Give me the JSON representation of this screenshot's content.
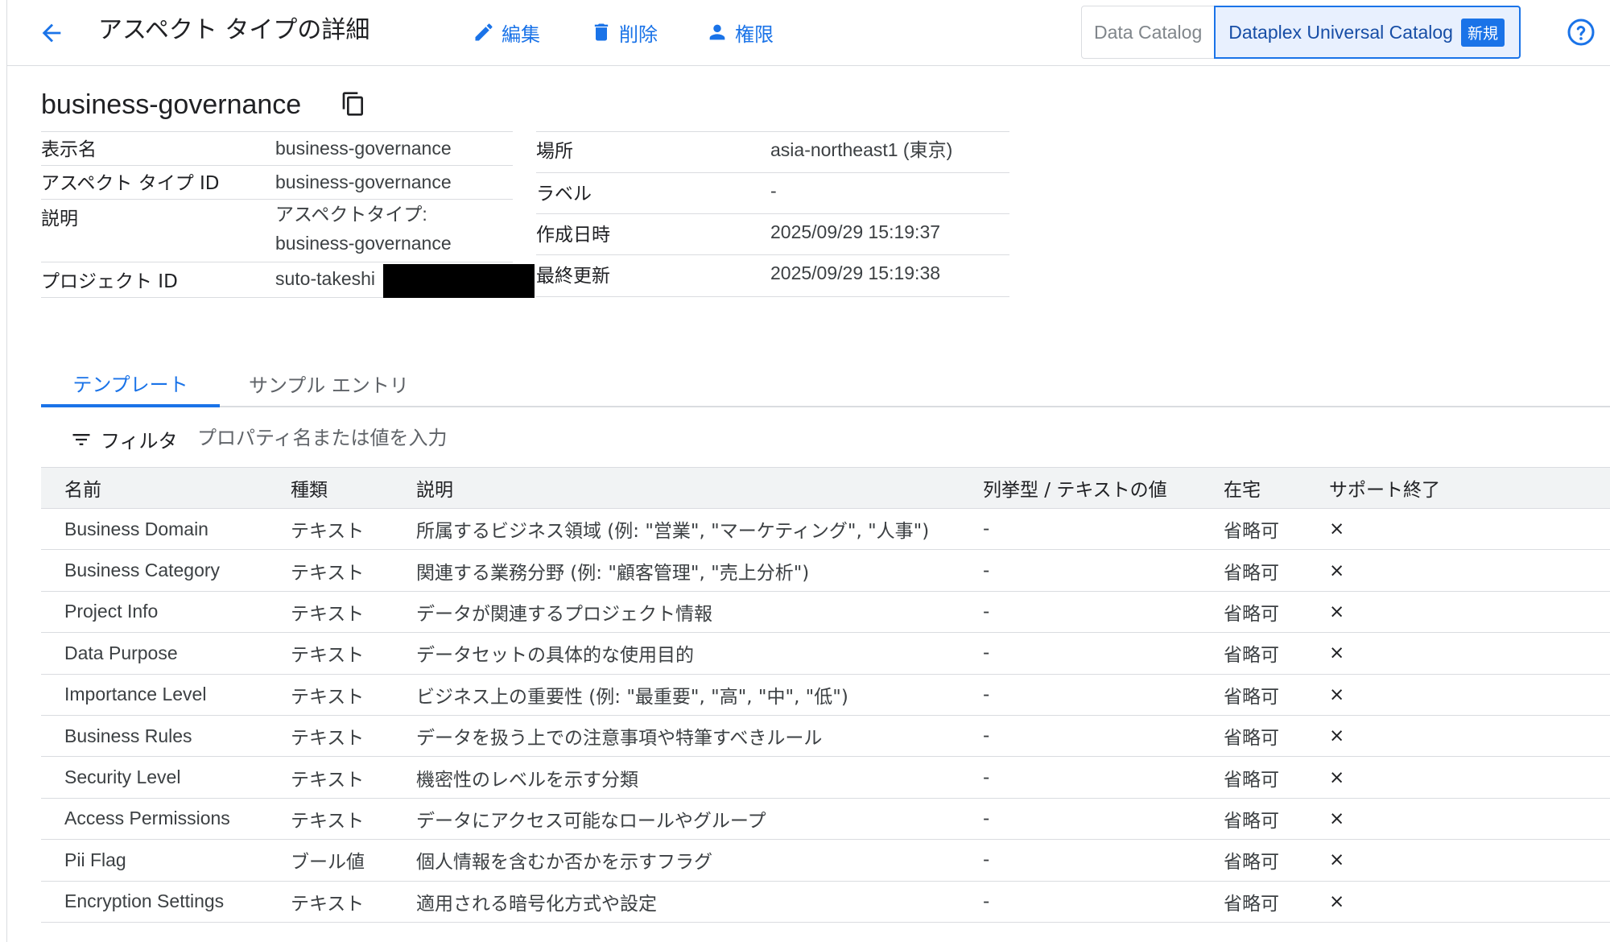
{
  "header": {
    "title": "アスペクト タイプの詳細",
    "actions": {
      "edit": "編集",
      "delete": "削除",
      "permissions": "権限"
    },
    "catalog_toggle": {
      "options": [
        "Data Catalog",
        "Dataplex Universal Catalog"
      ],
      "active": "Dataplex Universal Catalog",
      "badge": "新規"
    }
  },
  "resource": {
    "name": "business-governance"
  },
  "details_left": [
    {
      "label": "表示名",
      "value": "business-governance"
    },
    {
      "label": "アスペクト タイプ ID",
      "value": "business-governance"
    },
    {
      "label": "説明",
      "value_line1": "アスペクトタイプ:",
      "value_line2": "business-governance"
    },
    {
      "label": "プロジェクト ID",
      "value": "suto-takeshi"
    }
  ],
  "details_right": [
    {
      "label": "場所",
      "value": "asia-northeast1 (東京)"
    },
    {
      "label": "ラベル",
      "value": "-"
    },
    {
      "label": "作成日時",
      "value": "2025/09/29 15:19:37"
    },
    {
      "label": "最終更新",
      "value": "2025/09/29 15:19:38"
    }
  ],
  "tabs": [
    "テンプレート",
    "サンプル エントリ"
  ],
  "filter": {
    "label": "フィルタ",
    "placeholder": "プロパティ名または値を入力"
  },
  "table": {
    "headers": [
      "名前",
      "種類",
      "説明",
      "列挙型 / テキストの値",
      "在宅",
      "サポート終了"
    ],
    "rows": [
      [
        "Business Domain",
        "テキスト",
        "所属するビジネス領域 (例: \"営業\", \"マーケティング\", \"人事\")",
        "-",
        "省略可",
        "×"
      ],
      [
        "Business Category",
        "テキスト",
        "関連する業務分野 (例: \"顧客管理\", \"売上分析\")",
        "-",
        "省略可",
        "×"
      ],
      [
        "Project Info",
        "テキスト",
        "データが関連するプロジェクト情報",
        "-",
        "省略可",
        "×"
      ],
      [
        "Data Purpose",
        "テキスト",
        "データセットの具体的な使用目的",
        "-",
        "省略可",
        "×"
      ],
      [
        "Importance Level",
        "テキスト",
        "ビジネス上の重要性 (例: \"最重要\", \"高\", \"中\", \"低\")",
        "-",
        "省略可",
        "×"
      ],
      [
        "Business Rules",
        "テキスト",
        "データを扱う上での注意事項や特筆すべきルール",
        "-",
        "省略可",
        "×"
      ],
      [
        "Security Level",
        "テキスト",
        "機密性のレベルを示す分類",
        "-",
        "省略可",
        "×"
      ],
      [
        "Access Permissions",
        "テキスト",
        "データにアクセス可能なロールやグループ",
        "-",
        "省略可",
        "×"
      ],
      [
        "Pii Flag",
        "ブール値",
        "個人情報を含むか否かを示すフラグ",
        "-",
        "省略可",
        "×"
      ],
      [
        "Encryption Settings",
        "テキスト",
        "適用される暗号化方式や設定",
        "-",
        "省略可",
        "×"
      ]
    ]
  },
  "icons": {
    "back": "arrow-back-icon",
    "edit": "pencil-icon",
    "delete": "trash-icon",
    "permissions": "person-icon",
    "copy": "copy-icon",
    "filter": "filter-icon",
    "help": "help-circle-icon"
  },
  "colors": {
    "accent": "#1a73e8",
    "redaction": "#000000"
  }
}
